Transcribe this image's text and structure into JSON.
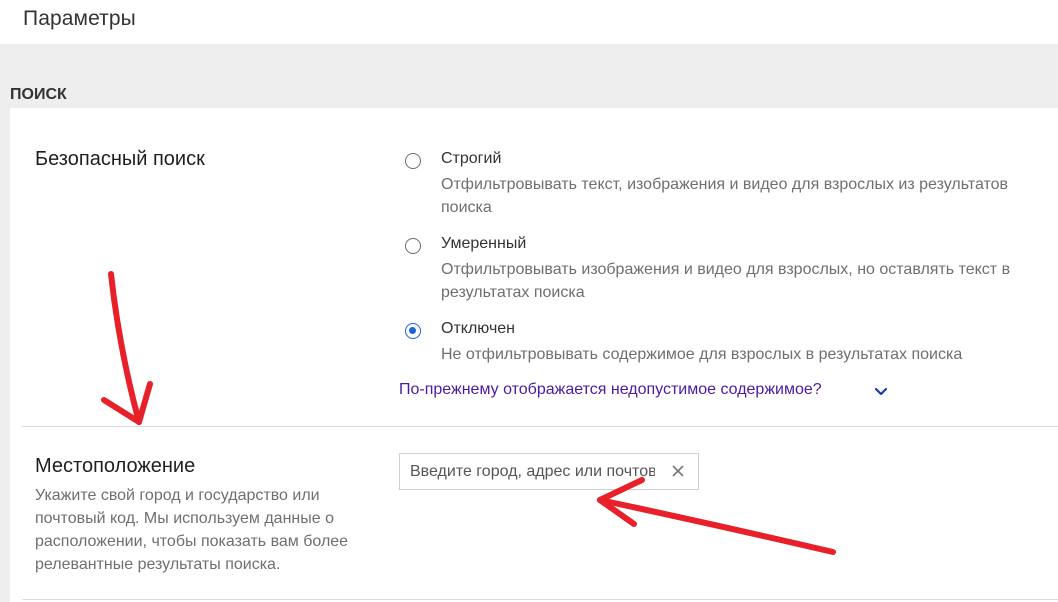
{
  "header": {
    "title": "Параметры"
  },
  "section": {
    "title": "ПОИСК"
  },
  "safe_search": {
    "label": "Безопасный поиск",
    "options": [
      {
        "title": "Строгий",
        "description": "Отфильтровывать текст, изображения и видео для взрослых из результатов поиска",
        "checked": false
      },
      {
        "title": "Умеренный",
        "description": "Отфильтровывать изображения и видео для взрослых, но оставлять текст в результатах поиска",
        "checked": false
      },
      {
        "title": "Отключен",
        "description": "Не отфильтровывать содержимое для взрослых в результатах поиска",
        "checked": true
      }
    ],
    "more_link": "По-прежнему отображается недопустимое содержимое?"
  },
  "location": {
    "label": "Местоположение",
    "description": "Укажите свой город и государство или почтовый код. Мы используем данные о расположении, чтобы показать вам более релевантные результаты поиска.",
    "input_placeholder": "Введите город, адрес или почтовый индекс",
    "input_value": ""
  },
  "colors": {
    "accent": "#1a62d6",
    "link": "#4b1aa3",
    "annotation_arrow": "#e8202a"
  },
  "icons": [
    "radio-icon",
    "chevron-down-icon",
    "clear-icon"
  ]
}
